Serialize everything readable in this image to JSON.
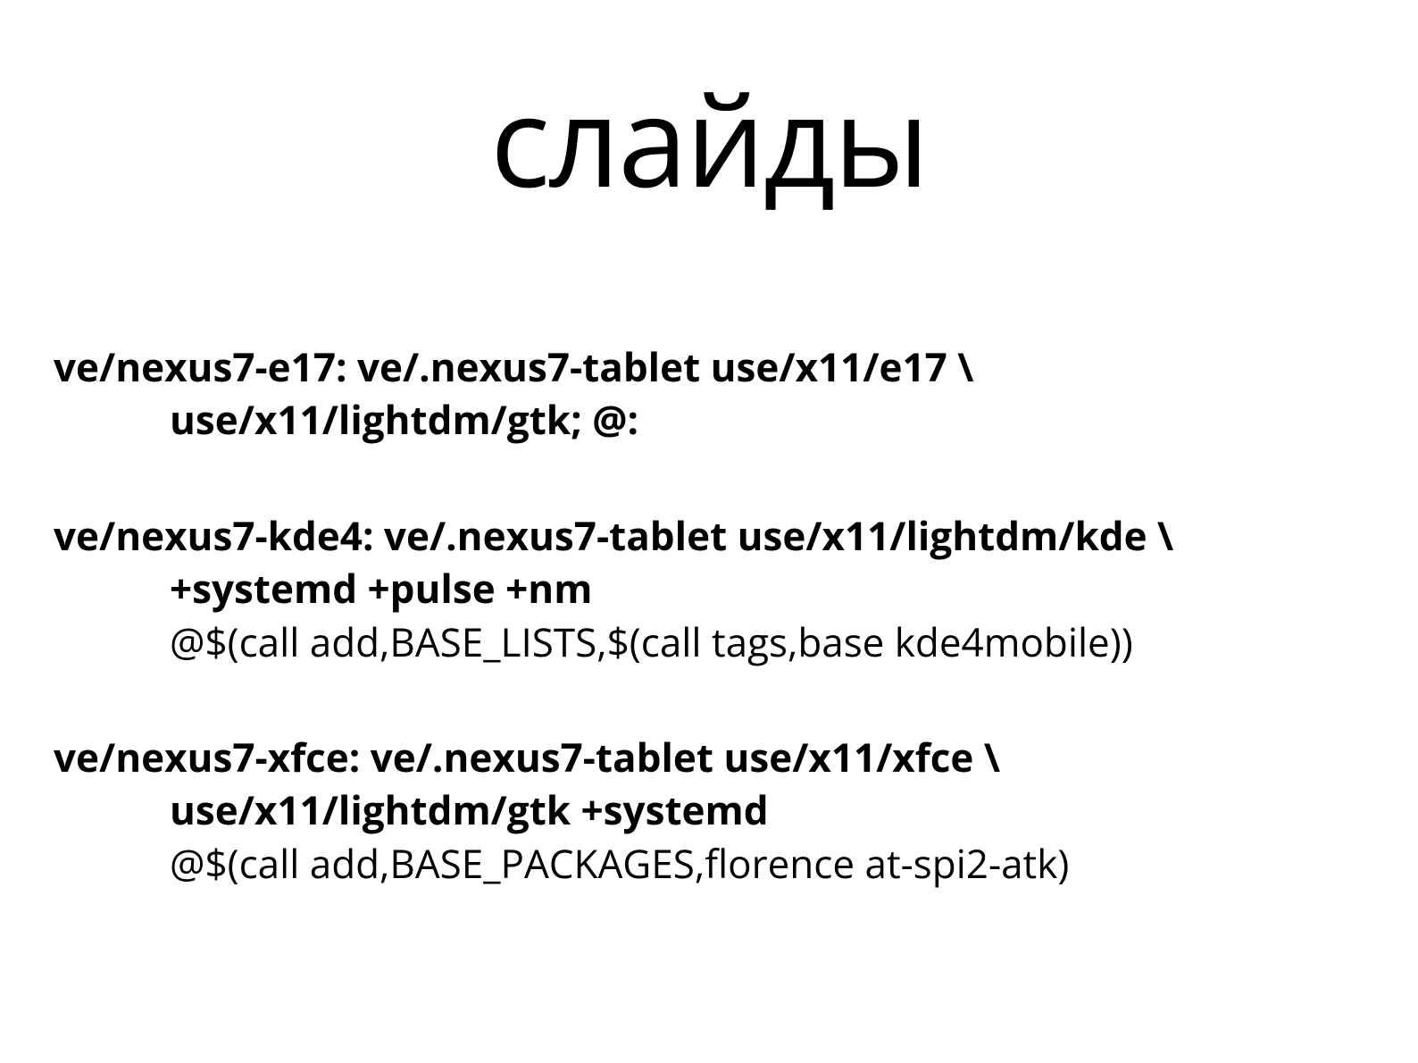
{
  "title": "слайды",
  "blocks": [
    {
      "line1": "ve/nexus7-e17: ve/.nexus7-tablet use/x11/e17 \\",
      "line2": "use/x11/lightdm/gtk; @:",
      "line3": ""
    },
    {
      "line1": "ve/nexus7-kde4: ve/.nexus7-tablet use/x11/lightdm/kde \\",
      "line2": "+systemd +pulse +nm",
      "line3": "@$(call add,BASE_LISTS,$(call tags,base kde4mobile))"
    },
    {
      "line1": "ve/nexus7-xfce: ve/.nexus7-tablet use/x11/xfce \\",
      "line2": "use/x11/lightdm/gtk +systemd",
      "line3": "@$(call add,BASE_PACKAGES,florence at-spi2-atk)"
    }
  ]
}
